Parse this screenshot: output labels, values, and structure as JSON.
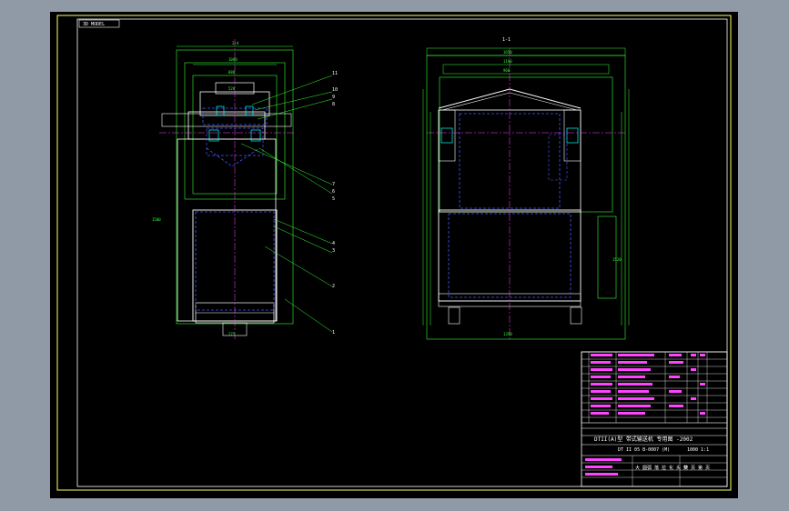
{
  "drawing": {
    "corner_tag": "3D MODEL",
    "section_label": "1-1",
    "callouts": [
      "11",
      "10",
      "9",
      "8",
      "7",
      "6",
      "5",
      "4",
      "3",
      "2",
      "1"
    ],
    "title_block": {
      "company": "DTII(A)型 带式输送机 专用图 -2002",
      "drawing_no": "DT II 05 B-0007 (M)",
      "sheet": "1000 1:1",
      "part_title": "大 圆弧 落 拉 化 头 架",
      "sheet_total": "共 页 第 页"
    }
  }
}
